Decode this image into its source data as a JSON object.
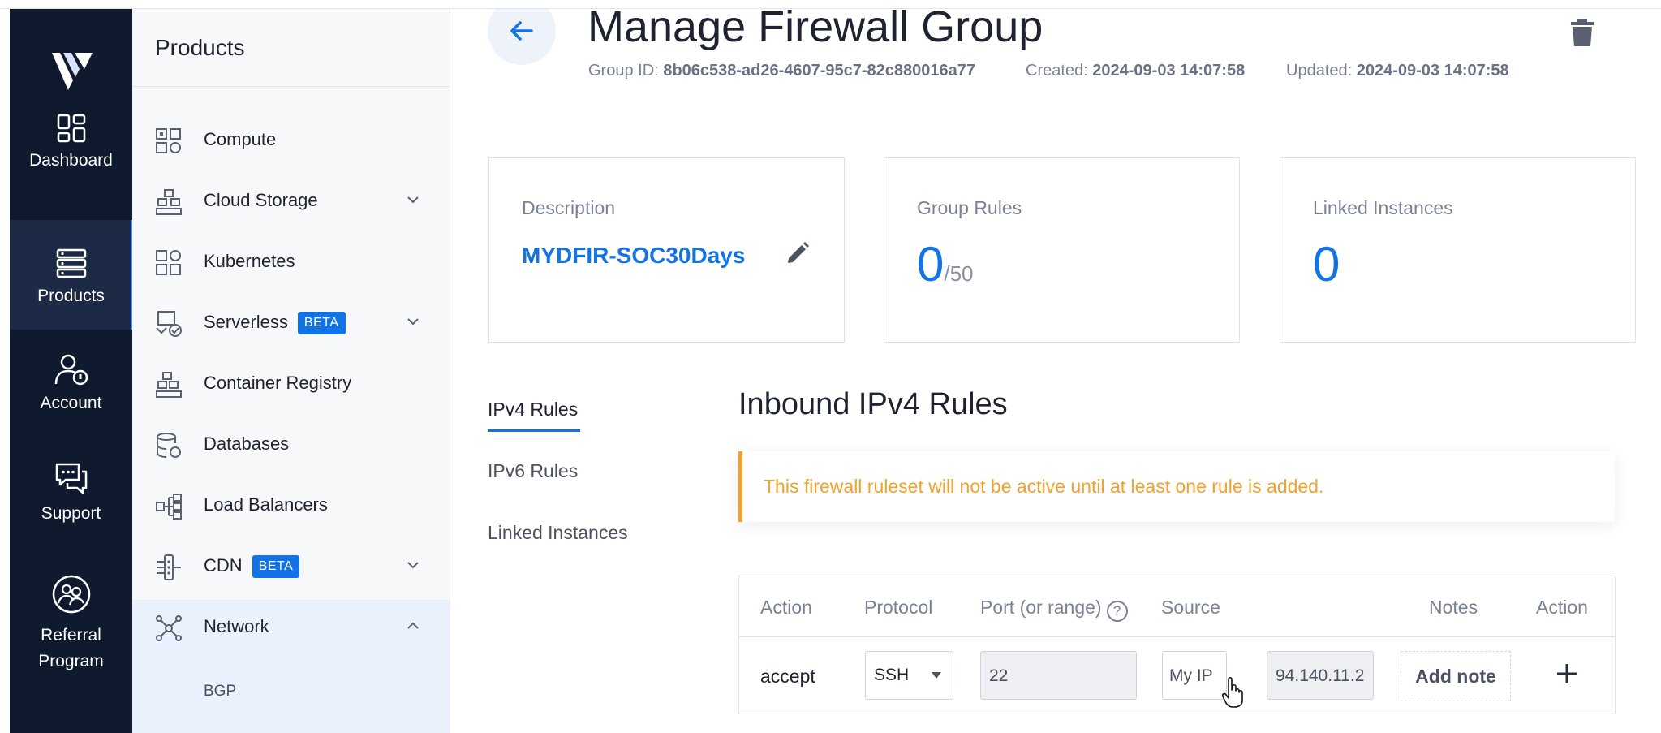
{
  "rail": {
    "items": [
      {
        "label": "Dashboard",
        "icon": "dashboard-icon"
      },
      {
        "label": "Products",
        "icon": "products-icon"
      },
      {
        "label": "Account",
        "icon": "account-icon"
      },
      {
        "label": "Support",
        "icon": "support-icon"
      },
      {
        "label": "Referral",
        "label2": "Program",
        "icon": "referral-icon"
      }
    ]
  },
  "panel": {
    "title": "Products",
    "items": [
      {
        "label": "Compute"
      },
      {
        "label": "Cloud Storage"
      },
      {
        "label": "Kubernetes"
      },
      {
        "label": "Serverless",
        "badge": "BETA"
      },
      {
        "label": "Container Registry"
      },
      {
        "label": "Databases"
      },
      {
        "label": "Load Balancers"
      },
      {
        "label": "CDN",
        "badge": "BETA"
      },
      {
        "label": "Network"
      }
    ],
    "subitems": [
      {
        "label": "BGP"
      }
    ]
  },
  "header": {
    "title": "Manage Firewall Group",
    "group_id_label": "Group ID:",
    "group_id": "8b06c538-ad26-4607-95c7-82c880016a77",
    "created_label": "Created:",
    "created": "2024-09-03 14:07:58",
    "updated_label": "Updated:",
    "updated": "2024-09-03 14:07:58"
  },
  "cards": {
    "description_label": "Description",
    "description_value": "MYDFIR-SOC30Days",
    "rules_label": "Group Rules",
    "rules_count": "0",
    "rules_max": "/50",
    "instances_label": "Linked Instances",
    "instances_count": "0"
  },
  "tabs": [
    {
      "label": "IPv4 Rules"
    },
    {
      "label": "IPv6 Rules"
    },
    {
      "label": "Linked Instances"
    }
  ],
  "rules": {
    "title": "Inbound IPv4 Rules",
    "alert": "This firewall ruleset will not be active until at least one rule is added.",
    "columns": [
      "Action",
      "Protocol",
      "Port (or range)",
      "Source",
      "Notes",
      "Action"
    ],
    "help_glyph": "?",
    "row": {
      "action": "accept",
      "protocol": "SSH",
      "port": "22",
      "source": "My IP",
      "ip": "94.140.11.2",
      "note_button": "Add note"
    }
  },
  "colors": {
    "rail": "#0f1a2f",
    "accent": "#1273e6",
    "warning": "#f0a22c"
  }
}
